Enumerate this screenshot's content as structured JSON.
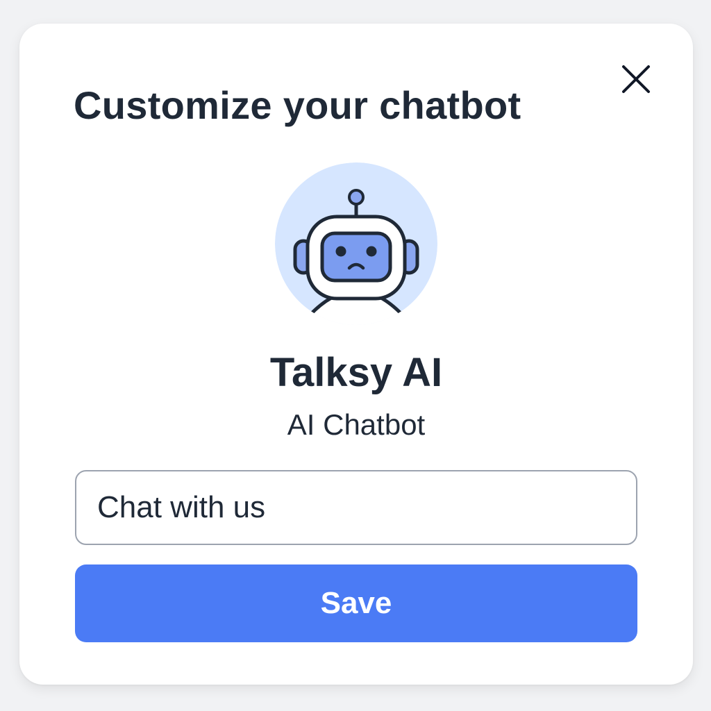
{
  "dialog": {
    "title": "Customize your chatbot",
    "close_icon": "close-icon"
  },
  "bot": {
    "avatar_icon": "robot-icon",
    "name": "Talksy AI",
    "subtitle": "AI Chatbot"
  },
  "greeting_input": {
    "value": "Chat with us"
  },
  "save_button": {
    "label": "Save"
  },
  "colors": {
    "primary_button": "#4b7bf5",
    "avatar_background": "#d6e6ff",
    "text": "#1f2937",
    "input_border": "#9ca3af"
  }
}
